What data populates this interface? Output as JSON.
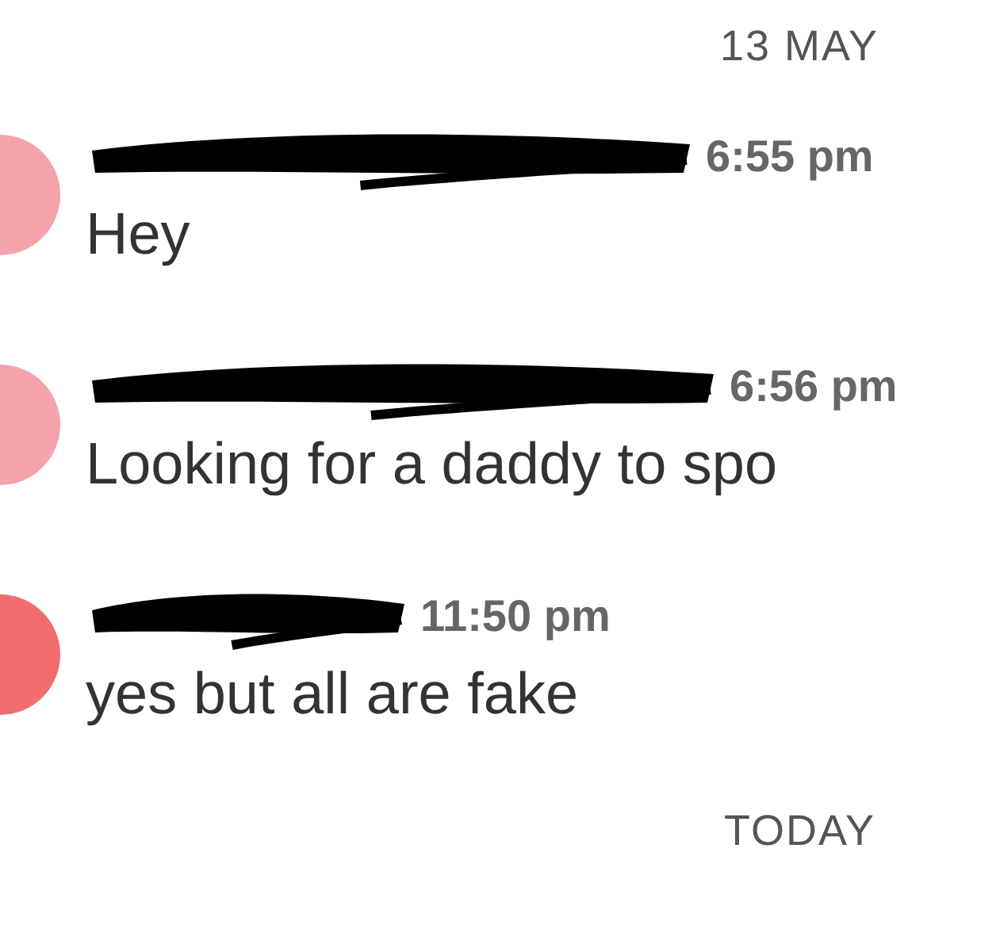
{
  "date_headers": [
    {
      "label": "13 MAY"
    },
    {
      "label": "TODAY"
    }
  ],
  "messages": [
    {
      "color": "#f4a3ab",
      "time": "6:55 pm",
      "text": "Hey"
    },
    {
      "color": "#f4a3ab",
      "time": "6:56 pm",
      "text": "Looking for a daddy to spo"
    },
    {
      "color": "#f26d6d",
      "time": "11:50 pm",
      "text": "yes but all are fake"
    }
  ]
}
